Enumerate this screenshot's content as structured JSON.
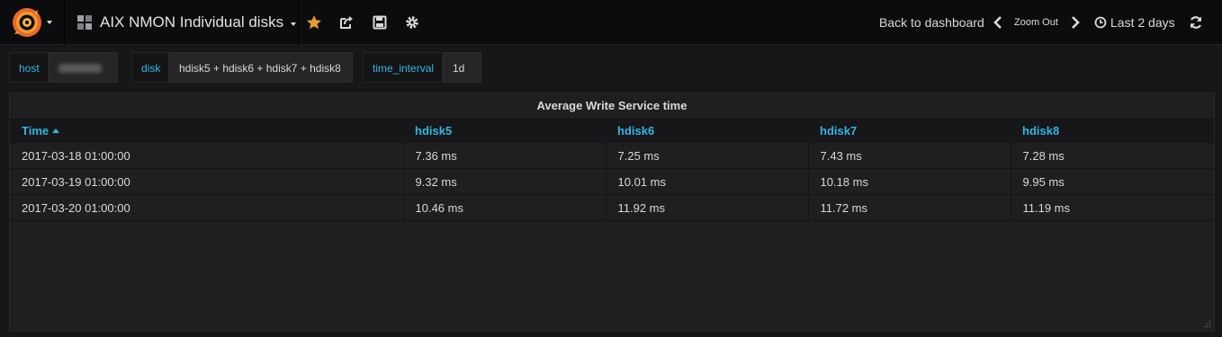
{
  "navbar": {
    "dashboard_title": "AIX NMON Individual disks",
    "back_label": "Back to dashboard",
    "zoom_label": "Zoom Out",
    "time_range_label": "Last 2 days"
  },
  "variables": [
    {
      "label": "host",
      "value": ""
    },
    {
      "label": "disk",
      "value": "hdisk5 + hdisk6 + hdisk7 + hdisk8"
    },
    {
      "label": "time_interval",
      "value": "1d"
    }
  ],
  "panel": {
    "title": "Average Write Service time",
    "columns": [
      "Time",
      "hdisk5",
      "hdisk6",
      "hdisk7",
      "hdisk8"
    ],
    "rows": [
      [
        "2017-03-18 01:00:00",
        "7.36 ms",
        "7.25 ms",
        "7.43 ms",
        "7.28 ms"
      ],
      [
        "2017-03-19 01:00:00",
        "9.32 ms",
        "10.01 ms",
        "10.18 ms",
        "9.95 ms"
      ],
      [
        "2017-03-20 01:00:00",
        "10.46 ms",
        "11.92 ms",
        "11.72 ms",
        "11.19 ms"
      ]
    ]
  },
  "colors": {
    "accent": "#33b5e5",
    "star": "#eb9a2f",
    "background": "#161719",
    "panel": "#1f1f20"
  },
  "icons": [
    "grafana-logo-icon",
    "dashboard-grid-icon",
    "star-icon",
    "share-icon",
    "save-icon",
    "gear-icon",
    "chevron-left-icon",
    "chevron-right-icon",
    "clock-icon",
    "refresh-icon"
  ]
}
